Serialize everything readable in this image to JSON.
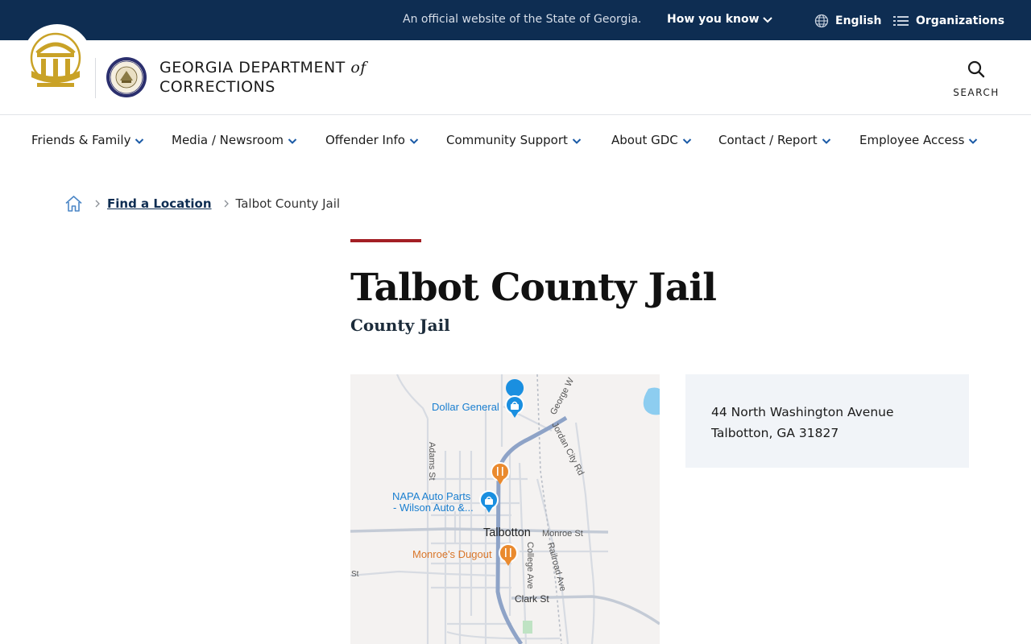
{
  "banner": {
    "official_text": "An official website of the State of Georgia.",
    "how_you_know": "How you know",
    "language": "English",
    "organizations": "Organizations"
  },
  "header": {
    "org_name_line1": "GEORGIA DEPARTMENT",
    "org_name_of": "of",
    "org_name_line2": "CORRECTIONS",
    "search_label": "SEARCH"
  },
  "nav": {
    "items": [
      {
        "label": "Friends & Family"
      },
      {
        "label": "Media / Newsroom"
      },
      {
        "label": "Offender Info"
      },
      {
        "label": "Community Support"
      },
      {
        "label": "About GDC"
      },
      {
        "label": "Contact / Report"
      },
      {
        "label": "Employee Access"
      }
    ]
  },
  "breadcrumb": {
    "parent": "Find a Location",
    "current": "Talbot County Jail"
  },
  "page": {
    "title": "Talbot County Jail",
    "subtitle": "County Jail"
  },
  "map": {
    "labels": {
      "dollar_general": "Dollar General",
      "napa_line1": "NAPA Auto Parts",
      "napa_line2": "- Wilson Auto &...",
      "talbotton": "Talbotton",
      "monroe_st": "Monroe St",
      "monroes_dugout": "Monroe's Dugout",
      "st": "St",
      "clark_st": "Clark St",
      "adams_st": "Adams St",
      "george_w": "George W",
      "jordan_city_rd": "Jordan City Rd",
      "college_ave": "College Ave",
      "railroad_ave": "Railroad Ave"
    },
    "colors": {
      "shop_pin": "#1a8fe0",
      "food_pin": "#ea8a2e",
      "highway": "#8ea3c7",
      "water": "#8dcdf0"
    }
  },
  "address": {
    "line1": "44 North Washington Avenue",
    "line2": "Talbotton, GA 31827"
  },
  "colors": {
    "banner_bg": "#0e2d52",
    "accent_red": "#a31f24",
    "seal_gold": "#c9a227",
    "card_bg": "#f1f4f8"
  }
}
